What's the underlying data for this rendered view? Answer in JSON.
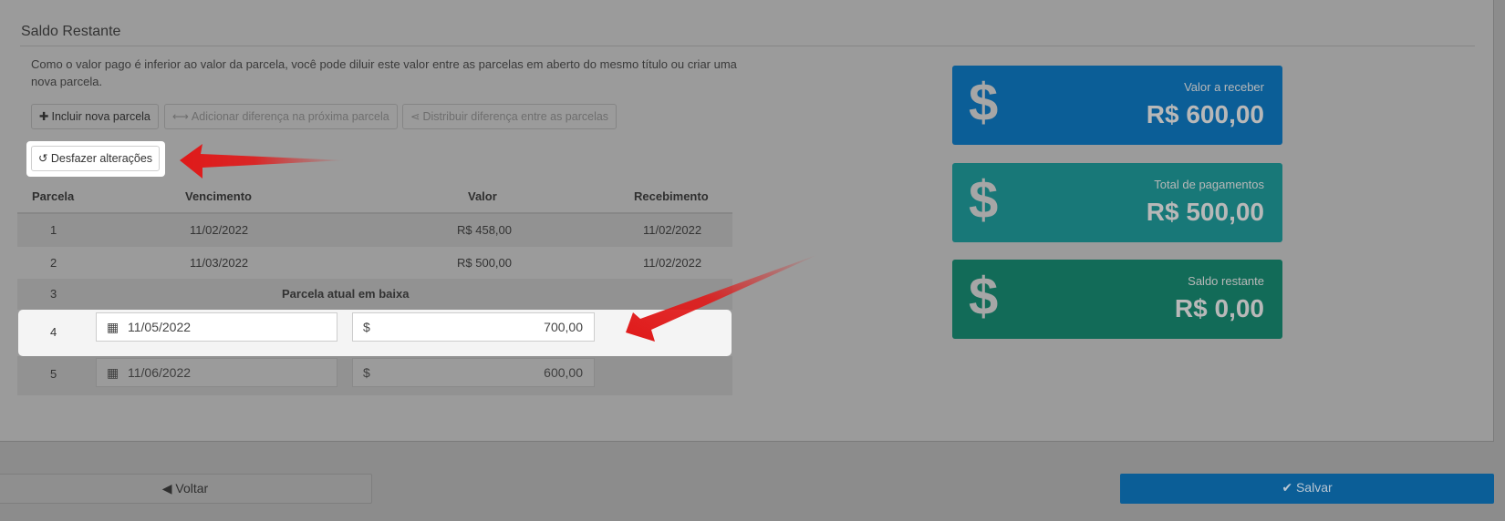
{
  "section": {
    "title": "Saldo Restante",
    "description": "Como o valor pago é inferior ao valor da parcela, você pode diluir este valor entre as parcelas em aberto do mesmo título ou criar uma nova parcela."
  },
  "actions": {
    "add_installment": "Incluir nova parcela",
    "add_difference_next": "Adicionar diferença na próxima parcela",
    "distribute_difference": "Distribuir diferença entre as parcelas",
    "undo_changes": "Desfazer alterações"
  },
  "table": {
    "headers": [
      "Parcela",
      "Vencimento",
      "Valor",
      "Recebimento"
    ],
    "rows": [
      {
        "parcela": "1",
        "vencimento": "11/02/2022",
        "valor": "R$ 458,00",
        "recebimento": "11/02/2022"
      },
      {
        "parcela": "2",
        "vencimento": "11/03/2022",
        "valor": "R$ 500,00",
        "recebimento": "11/02/2022"
      },
      {
        "parcela": "3",
        "note": "Parcela atual em baixa"
      },
      {
        "parcela": "4",
        "vencimento": "11/05/2022",
        "currency": "$",
        "valor": "700,00"
      },
      {
        "parcela": "5",
        "vencimento": "11/06/2022",
        "currency": "$",
        "valor": "600,00"
      }
    ]
  },
  "cards": [
    {
      "label": "Valor a receber",
      "value": "R$ 600,00",
      "icon": "$",
      "color": "#0b5e97"
    },
    {
      "label": "Total de pagamentos",
      "value": "R$ 500,00",
      "icon": "$",
      "color": "#187878"
    },
    {
      "label": "Saldo restante",
      "value": "R$ 0,00",
      "icon": "$",
      "color": "#126b58"
    }
  ],
  "footer": {
    "back_label": "Voltar",
    "save_label": "Salvar"
  },
  "colors": {
    "overlay": "#9b9b9b",
    "primary": "#0b5e97",
    "annotation_arrow": "#e01919"
  }
}
